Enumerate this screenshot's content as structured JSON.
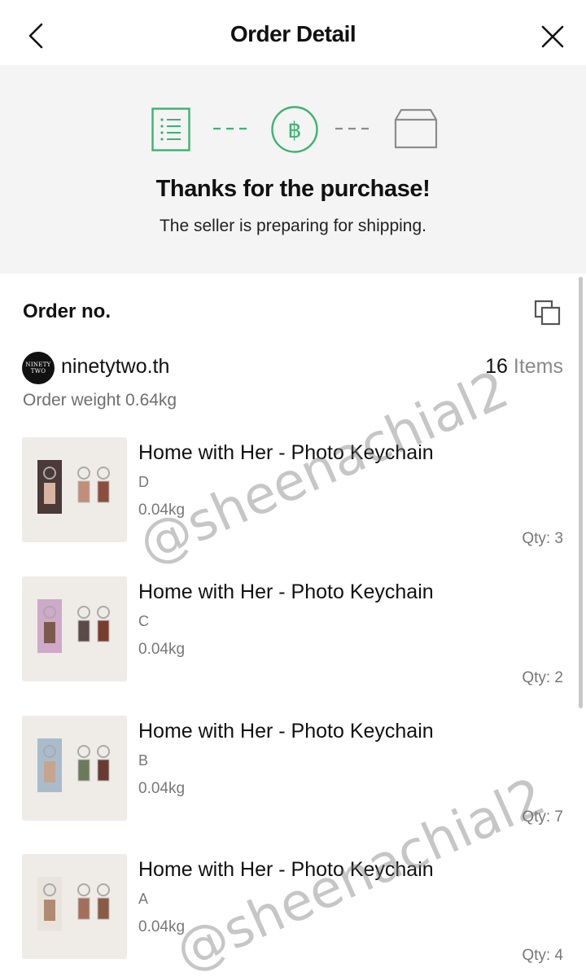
{
  "header": {
    "title": "Order Detail"
  },
  "status": {
    "steps": [
      {
        "name": "order-placed",
        "icon": "list-icon",
        "state": "active"
      },
      {
        "name": "payment",
        "icon": "baht-coin-icon",
        "state": "active",
        "symbol": "฿"
      },
      {
        "name": "shipping",
        "icon": "box-icon",
        "state": "pending"
      }
    ],
    "title": "Thanks for the purchase!",
    "subtitle": "The seller is preparing for shipping.",
    "accent_color": "#3cb371",
    "pending_color": "#8c8c8c"
  },
  "order": {
    "label": "Order no."
  },
  "shop": {
    "avatar_text_top": "NINETY",
    "avatar_text_bottom": "TWO",
    "name": "ninetytwo.th",
    "items_count": "16",
    "items_word": "Items",
    "weight": "Order weight 0.64kg"
  },
  "products": [
    {
      "name": "Home with Her - Photo Keychain",
      "variant": "D",
      "weight": "0.04kg",
      "qty": "Qty: 3",
      "card_color": "#4a3a38"
    },
    {
      "name": "Home with Her - Photo Keychain",
      "variant": "C",
      "weight": "0.04kg",
      "qty": "Qty: 2",
      "card_color": "#cfa9c9"
    },
    {
      "name": "Home with Her - Photo Keychain",
      "variant": "B",
      "weight": "0.04kg",
      "qty": "Qty: 7",
      "card_color": "#a9bccb"
    },
    {
      "name": "Home with Her - Photo Keychain",
      "variant": "A",
      "weight": "0.04kg",
      "qty": "Qty: 4",
      "card_color": "#e8e4dc"
    }
  ],
  "watermark": "@sheenachial2"
}
